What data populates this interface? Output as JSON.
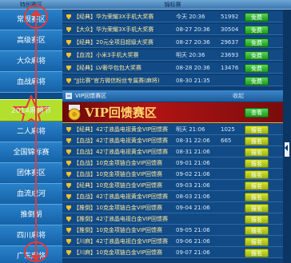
{
  "header": {
    "left_title": "特别赛区",
    "right_title": "锦标赛"
  },
  "sidebar": {
    "items": [
      {
        "label": "常规赛区"
      },
      {
        "label": "高级赛区"
      },
      {
        "label": "大众麻将"
      },
      {
        "label": "血战麻将"
      },
      {
        "label": "2014麻将节"
      },
      {
        "label": "二人麻将"
      },
      {
        "label": "全国锦标赛"
      },
      {
        "label": "团体赛区"
      },
      {
        "label": "血流成河"
      },
      {
        "label": "推倒胡"
      },
      {
        "label": "四川麻将"
      },
      {
        "label": "广东麻将"
      }
    ]
  },
  "top_rows": [
    {
      "name": "【经典】华为荣耀3X手机大奖赛",
      "time": "今天 20:36",
      "count": "51992",
      "button": "免费"
    },
    {
      "name": "【大众】华为荣耀3X手机大奖赛",
      "time": "08-27 20:36",
      "count": "30504",
      "button": "免费"
    },
    {
      "name": "【经典】20元全项目超级大奖赛",
      "time": "08-27 20:36",
      "count": "29637",
      "button": "免费"
    },
    {
      "name": "【血流】小米3手机大奖赛",
      "time": "明天 20:36",
      "count": "23693",
      "button": "免费"
    },
    {
      "name": "【经典】LV奢华包包大奖赛",
      "time": "08-28 20:36",
      "count": "13476",
      "button": "免费"
    },
    {
      "name": "“JJ比赛”官方微信粉丝专属赛(麻将)",
      "time": "08-30 21:35",
      "count": "",
      "button": "免费"
    }
  ],
  "vip_section": {
    "header_title": "VIP回馈赛区",
    "header_right": "收起",
    "banner_title": "VIP回馈赛区",
    "watch_label": "查看",
    "rows": [
      {
        "name": "【经典】42寸液晶电视黄金VIP回馈赛",
        "time": "明天 21:06",
        "count": "1025",
        "button": "报名"
      },
      {
        "name": "【血战】42寸液晶电视黄金VIP回馈赛",
        "time": "08-31 22:06",
        "count": "665",
        "button": "报名"
      },
      {
        "name": "【血战】42寸液晶电视黄金VIP回馈赛",
        "time": "08-31 21:06",
        "count": "",
        "button": "报名"
      },
      {
        "name": "【血战】10克金项链白金VIP回馈赛",
        "time": "09-01 21:06",
        "count": "",
        "button": "报名"
      },
      {
        "name": "【血战】10克金项链白金VIP回馈赛",
        "time": "09-02 21:06",
        "count": "",
        "button": "报名"
      },
      {
        "name": "【经典】10克金项链白金VIP回馈赛",
        "time": "09-03 21:06",
        "count": "",
        "button": "报名"
      },
      {
        "name": "【血战】42寸液晶电视黄金VIP回馈赛",
        "time": "08-03 21:06",
        "count": "",
        "button": "报名"
      },
      {
        "name": "【推倒】10克金项链白金VIP回馈赛",
        "time": "09-04 21:06",
        "count": "",
        "button": "报名"
      },
      {
        "name": "【推倒】42寸液晶电视白金VIP回馈赛",
        "time": "",
        "count": "",
        "button": "报名"
      },
      {
        "name": "【推倒】10克金项链白金VIP回馈赛",
        "time": "09-05 21:06",
        "count": "",
        "button": "报名"
      },
      {
        "name": "【川麻】42寸液晶电视白金VIP回馈赛",
        "time": "09-06 21:06",
        "count": "",
        "button": "报名"
      },
      {
        "name": "【川麻】10克金项链白金VIP回馈赛",
        "time": "09-07 21:06",
        "count": "",
        "button": "报名"
      }
    ]
  },
  "colors": {
    "accent_green": "#1c9a1c",
    "vip_red": "#b21414",
    "active_tab": "#b3e02d",
    "annotation_red": "#e23b3b"
  },
  "icons": {
    "trophy": "trophy-icon",
    "medal": "medal-icon",
    "star": "star-icon"
  }
}
